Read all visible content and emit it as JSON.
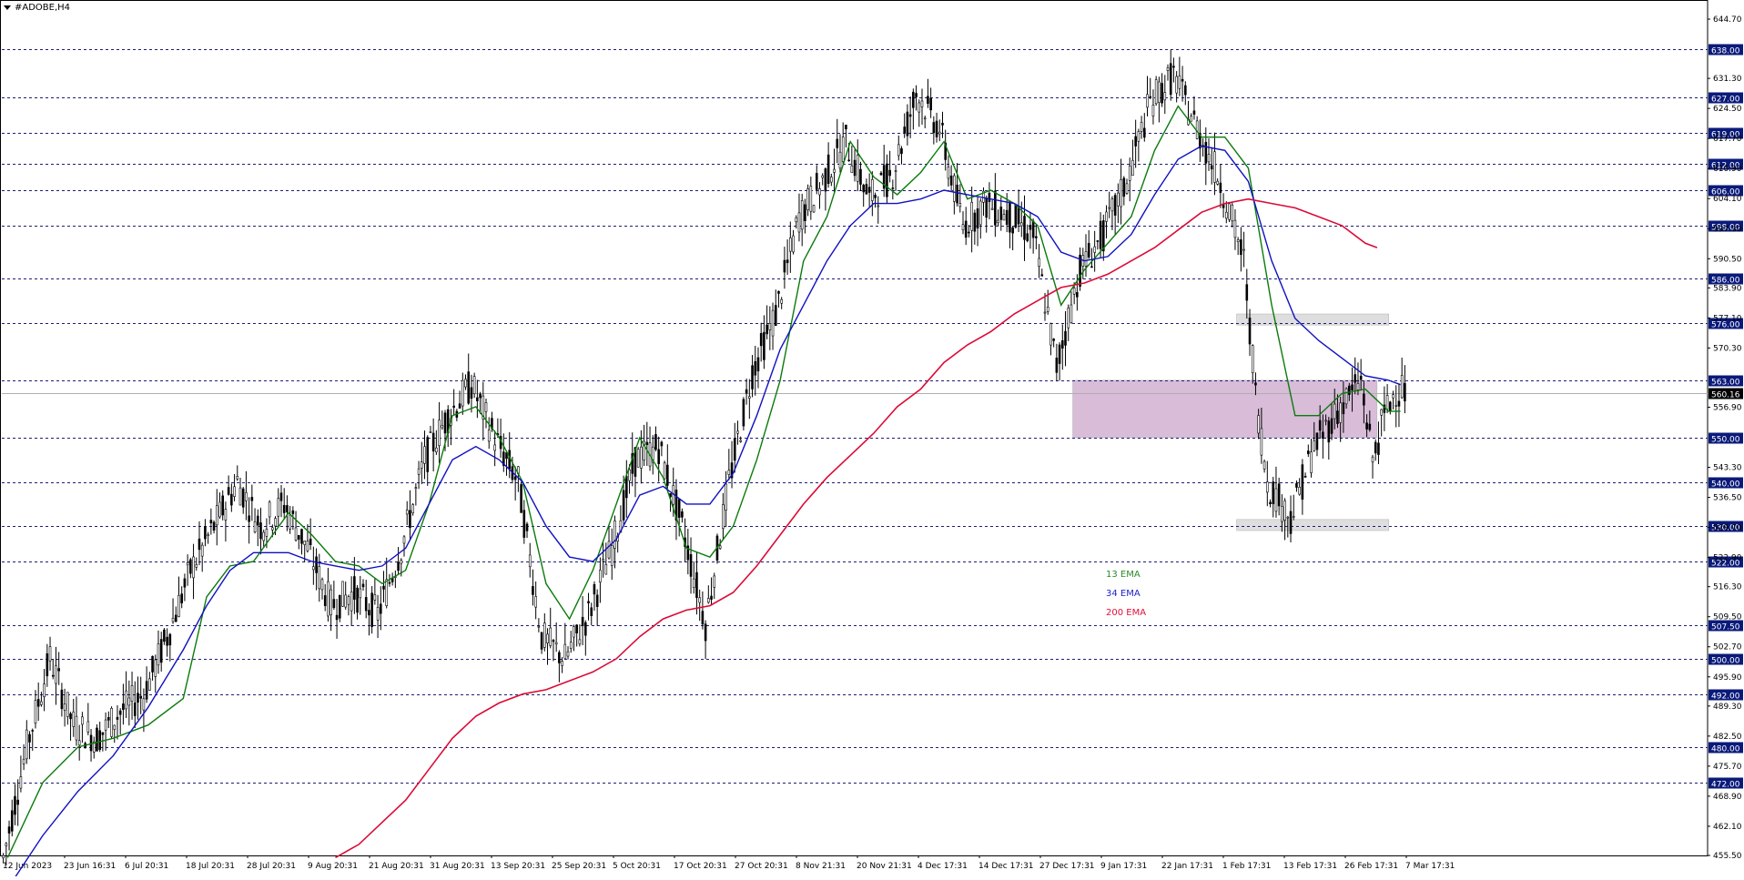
{
  "chart_data": {
    "type": "candlestick",
    "title": "#ADOBE,H4",
    "ylim": [
      455.5,
      648.0
    ],
    "y_ticks": [
      "644.70",
      "638.00",
      "631.30",
      "627.00",
      "624.50",
      "619.00",
      "617.70",
      "612.00",
      "610.90",
      "606.00",
      "604.10",
      "598.00",
      "597.30",
      "590.50",
      "586.00",
      "583.90",
      "577.10",
      "576.00",
      "570.30",
      "563.00",
      "560.16",
      "556.90",
      "550.00",
      "543.30",
      "540.00",
      "536.50",
      "530.00",
      "529.70",
      "522.00",
      "522.90",
      "516.30",
      "509.50",
      "507.50",
      "502.70",
      "500.00",
      "495.90",
      "492.00",
      "489.30",
      "482.50",
      "480.00",
      "475.70",
      "472.00",
      "468.90",
      "462.10",
      "455.50"
    ],
    "levels": [
      "638.00",
      "627.00",
      "619.00",
      "612.00",
      "606.00",
      "598.00",
      "586.00",
      "576.00",
      "563.00",
      "550.00",
      "540.00",
      "530.00",
      "522.00",
      "507.50",
      "500.00",
      "492.00",
      "480.00",
      "472.00"
    ],
    "current_price": "560.16",
    "x_ticks": [
      "12 Jun 2023",
      "23 Jun 16:31",
      "6 Jul 20:31",
      "18 Jul 20:31",
      "28 Jul 20:31",
      "9 Aug 20:31",
      "21 Aug 20:31",
      "31 Aug 20:31",
      "13 Sep 20:31",
      "25 Sep 20:31",
      "5 Oct 20:31",
      "17 Oct 20:31",
      "27 Oct 20:31",
      "8 Nov 21:31",
      "20 Nov 21:31",
      "4 Dec 17:31",
      "14 Dec 17:31",
      "27 Dec 17:31",
      "9 Jan 17:31",
      "22 Jan 17:31",
      "1 Feb 17:31",
      "13 Feb 17:31",
      "26 Feb 17:31",
      "7 Mar 17:31"
    ],
    "legend": [
      {
        "name": "13 EMA",
        "color": "#2a8a2a"
      },
      {
        "name": "34 EMA",
        "color": "#1e22c8"
      },
      {
        "name": "200 EMA",
        "color": "#e0103a"
      }
    ],
    "series": [
      {
        "name": "13 EMA",
        "color": "#0b7a0b",
        "points": [
          [
            0,
            455
          ],
          [
            3,
            472
          ],
          [
            6,
            480
          ],
          [
            9,
            482
          ],
          [
            12,
            485
          ],
          [
            15,
            491
          ],
          [
            17,
            514
          ],
          [
            19,
            521
          ],
          [
            21,
            522
          ],
          [
            24,
            533
          ],
          [
            26,
            528
          ],
          [
            28,
            522
          ],
          [
            30,
            521
          ],
          [
            32,
            517
          ],
          [
            34,
            520
          ],
          [
            36,
            535
          ],
          [
            38,
            555
          ],
          [
            40,
            557
          ],
          [
            42,
            550
          ],
          [
            44,
            540
          ],
          [
            46,
            517
          ],
          [
            48,
            509
          ],
          [
            50,
            520
          ],
          [
            52,
            535
          ],
          [
            54,
            550
          ],
          [
            56,
            541
          ],
          [
            58,
            525
          ],
          [
            60,
            523
          ],
          [
            62,
            530
          ],
          [
            64,
            545
          ],
          [
            66,
            563
          ],
          [
            68,
            590
          ],
          [
            70,
            600
          ],
          [
            72,
            617
          ],
          [
            74,
            609
          ],
          [
            76,
            605
          ],
          [
            78,
            610
          ],
          [
            80,
            617
          ],
          [
            82,
            604
          ],
          [
            84,
            606
          ],
          [
            86,
            603
          ],
          [
            88,
            598
          ],
          [
            90,
            580
          ],
          [
            92,
            588
          ],
          [
            94,
            594
          ],
          [
            96,
            600
          ],
          [
            98,
            615
          ],
          [
            100,
            625
          ],
          [
            102,
            618
          ],
          [
            104,
            618
          ],
          [
            106,
            611
          ],
          [
            108,
            580
          ],
          [
            110,
            555
          ],
          [
            112,
            555
          ],
          [
            114,
            560
          ],
          [
            116,
            561
          ],
          [
            118,
            556
          ],
          [
            119,
            556
          ]
        ]
      },
      {
        "name": "34 EMA",
        "color": "#1010c0",
        "points": [
          [
            0,
            448
          ],
          [
            3,
            460
          ],
          [
            6,
            470
          ],
          [
            9,
            478
          ],
          [
            12,
            489
          ],
          [
            15,
            502
          ],
          [
            17,
            512
          ],
          [
            19,
            520
          ],
          [
            21,
            524
          ],
          [
            24,
            524
          ],
          [
            26,
            522
          ],
          [
            28,
            521
          ],
          [
            30,
            520
          ],
          [
            32,
            521
          ],
          [
            34,
            525
          ],
          [
            36,
            535
          ],
          [
            38,
            545
          ],
          [
            40,
            548
          ],
          [
            42,
            545
          ],
          [
            44,
            540
          ],
          [
            46,
            530
          ],
          [
            48,
            523
          ],
          [
            50,
            522
          ],
          [
            52,
            527
          ],
          [
            54,
            537
          ],
          [
            56,
            539
          ],
          [
            58,
            535
          ],
          [
            60,
            535
          ],
          [
            62,
            542
          ],
          [
            64,
            555
          ],
          [
            66,
            570
          ],
          [
            68,
            580
          ],
          [
            70,
            590
          ],
          [
            72,
            598
          ],
          [
            74,
            603
          ],
          [
            76,
            603
          ],
          [
            78,
            604
          ],
          [
            80,
            606
          ],
          [
            82,
            605
          ],
          [
            84,
            604
          ],
          [
            86,
            603
          ],
          [
            88,
            600
          ],
          [
            90,
            592
          ],
          [
            92,
            590
          ],
          [
            94,
            591
          ],
          [
            96,
            596
          ],
          [
            98,
            605
          ],
          [
            100,
            613
          ],
          [
            102,
            616
          ],
          [
            104,
            615
          ],
          [
            106,
            608
          ],
          [
            108,
            590
          ],
          [
            110,
            577
          ],
          [
            112,
            572
          ],
          [
            114,
            568
          ],
          [
            116,
            564
          ],
          [
            118,
            563
          ],
          [
            119,
            562
          ]
        ]
      },
      {
        "name": "200 EMA",
        "color": "#dc0a35",
        "points": [
          [
            28,
            455
          ],
          [
            30,
            458
          ],
          [
            32,
            463
          ],
          [
            34,
            468
          ],
          [
            36,
            475
          ],
          [
            38,
            482
          ],
          [
            40,
            487
          ],
          [
            42,
            490
          ],
          [
            44,
            492
          ],
          [
            46,
            493
          ],
          [
            48,
            495
          ],
          [
            50,
            497
          ],
          [
            52,
            500
          ],
          [
            54,
            505
          ],
          [
            56,
            509
          ],
          [
            58,
            511
          ],
          [
            60,
            512
          ],
          [
            62,
            515
          ],
          [
            64,
            521
          ],
          [
            66,
            528
          ],
          [
            68,
            535
          ],
          [
            70,
            541
          ],
          [
            72,
            546
          ],
          [
            74,
            551
          ],
          [
            76,
            557
          ],
          [
            78,
            561
          ],
          [
            80,
            567
          ],
          [
            82,
            571
          ],
          [
            84,
            574
          ],
          [
            86,
            578
          ],
          [
            88,
            581
          ],
          [
            90,
            584
          ],
          [
            92,
            585
          ],
          [
            94,
            587
          ],
          [
            96,
            590
          ],
          [
            98,
            593
          ],
          [
            100,
            597
          ],
          [
            102,
            601
          ],
          [
            104,
            603
          ],
          [
            106,
            604
          ],
          [
            108,
            603
          ],
          [
            110,
            602
          ],
          [
            112,
            600
          ],
          [
            114,
            598
          ],
          [
            116,
            594
          ],
          [
            117,
            593
          ]
        ]
      }
    ],
    "price_path": [
      [
        0,
        455
      ],
      [
        2,
        480
      ],
      [
        4,
        500
      ],
      [
        6,
        485
      ],
      [
        8,
        482
      ],
      [
        10,
        488
      ],
      [
        12,
        492
      ],
      [
        14,
        505
      ],
      [
        16,
        520
      ],
      [
        18,
        530
      ],
      [
        20,
        540
      ],
      [
        22,
        530
      ],
      [
        24,
        535
      ],
      [
        26,
        525
      ],
      [
        28,
        512
      ],
      [
        30,
        515
      ],
      [
        32,
        510
      ],
      [
        34,
        525
      ],
      [
        36,
        545
      ],
      [
        38,
        555
      ],
      [
        40,
        562
      ],
      [
        42,
        550
      ],
      [
        44,
        540
      ],
      [
        46,
        505
      ],
      [
        48,
        500
      ],
      [
        50,
        510
      ],
      [
        52,
        525
      ],
      [
        54,
        545
      ],
      [
        56,
        548
      ],
      [
        58,
        530
      ],
      [
        60,
        508
      ],
      [
        62,
        540
      ],
      [
        64,
        565
      ],
      [
        66,
        578
      ],
      [
        68,
        600
      ],
      [
        70,
        608
      ],
      [
        72,
        617
      ],
      [
        74,
        604
      ],
      [
        76,
        610
      ],
      [
        78,
        628
      ],
      [
        80,
        620
      ],
      [
        82,
        598
      ],
      [
        84,
        603
      ],
      [
        86,
        600
      ],
      [
        88,
        596
      ],
      [
        90,
        566
      ],
      [
        92,
        588
      ],
      [
        94,
        596
      ],
      [
        96,
        608
      ],
      [
        98,
        626
      ],
      [
        100,
        632
      ],
      [
        102,
        620
      ],
      [
        104,
        608
      ],
      [
        106,
        590
      ],
      [
        107,
        560
      ],
      [
        108,
        540
      ],
      [
        110,
        532
      ],
      [
        112,
        548
      ],
      [
        114,
        556
      ],
      [
        116,
        563
      ],
      [
        117,
        545
      ],
      [
        118,
        555
      ],
      [
        119,
        561
      ]
    ],
    "rect_zones": [
      {
        "y1": 550.0,
        "y2": 563.0,
        "x1": 91,
        "x2": 117,
        "fill": "#d8bcd8"
      },
      {
        "y1": 575.5,
        "y2": 578.0,
        "x1": 105,
        "x2": 118,
        "fill": "#dedede"
      },
      {
        "y1": 529.0,
        "y2": 531.5,
        "x1": 105,
        "x2": 118,
        "fill": "#dedede"
      }
    ],
    "n_bars": 120
  }
}
